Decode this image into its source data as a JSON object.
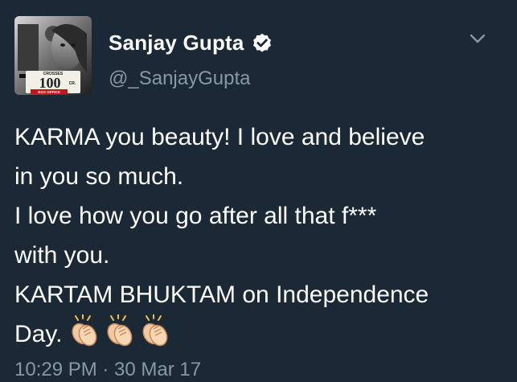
{
  "tweet": {
    "display_name": "Sanjay Gupta",
    "handle": "@_SanjayGupta",
    "text_lines": [
      "KARMA you beauty! I love and believe",
      "in you so much.",
      "I love how you go after all that f***",
      "with you.",
      "KARTAM BHUKTAM on Independence",
      "Day."
    ],
    "emoji": [
      "clapping-hands-icon",
      "clapping-hands-icon",
      "clapping-hands-icon"
    ],
    "timestamp": "10:29 PM · 30 Mar 17"
  },
  "avatar": {
    "badge_top": "CROSSES",
    "badge_number": "100",
    "badge_unit": "CR.",
    "badge_bottom": "BOX OFFICE"
  },
  "colors": {
    "background": "#1b2836",
    "text": "#ffffff",
    "secondary_text": "#8899a6"
  }
}
